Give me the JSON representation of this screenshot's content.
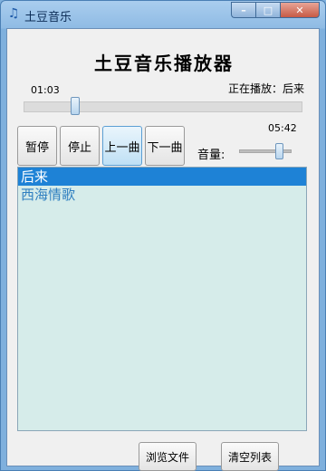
{
  "window": {
    "title": "土豆音乐",
    "app_icon": "music-note-icon",
    "controls": {
      "minimize": "–",
      "maximize": "□",
      "close": "✕"
    }
  },
  "player": {
    "heading": "土豆音乐播放器",
    "current_time": "01:03",
    "total_time": "05:42",
    "now_playing": "正在播放：后来",
    "seek_progress": 0.18,
    "volume_label": "音量:",
    "volume_level": 0.75
  },
  "controls": {
    "pause": "暂停",
    "stop": "停止",
    "prev": "上一曲",
    "next": "下一曲"
  },
  "playlist": {
    "items": [
      "后来",
      "西海情歌"
    ],
    "selected_index": 0
  },
  "actions": {
    "browse": "浏览文件",
    "clear": "清空列表"
  }
}
